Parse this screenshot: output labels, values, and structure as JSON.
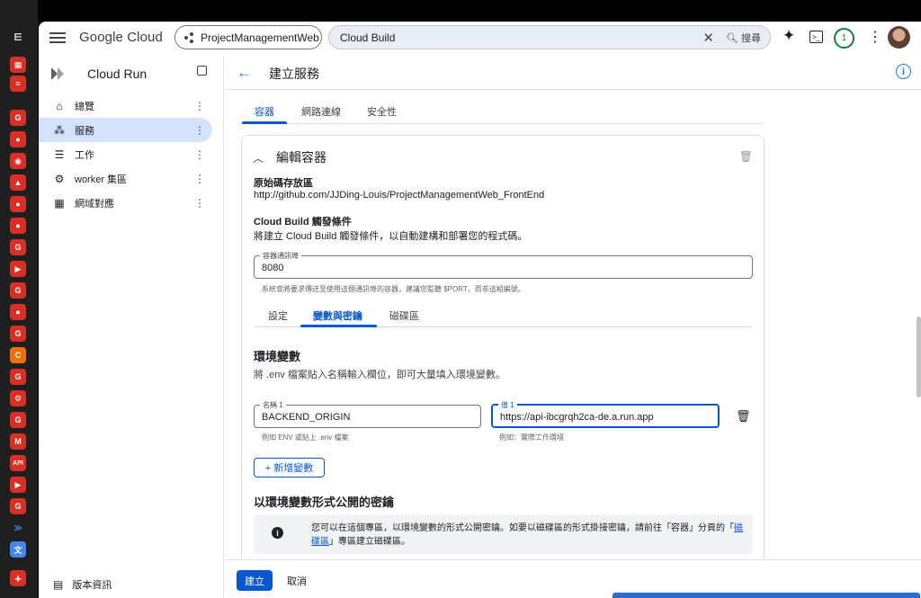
{
  "topbar": {
    "brand": "Google Cloud",
    "project": "ProjectManagementWeb",
    "search_value": "Cloud Build",
    "search_label": "搜尋",
    "notification_count": "1"
  },
  "sidebar": {
    "title": "Cloud Run",
    "items": [
      {
        "label": "總覽",
        "icon": "home-icon"
      },
      {
        "label": "服務",
        "icon": "services-icon"
      },
      {
        "label": "工作",
        "icon": "jobs-icon"
      },
      {
        "label": "worker 集區",
        "icon": "worker-pool-icon"
      },
      {
        "label": "網域對應",
        "icon": "domain-icon"
      }
    ],
    "footer": "版本資訊"
  },
  "page": {
    "title": "建立服務",
    "tabs": [
      "容器",
      "網路連線",
      "安全性"
    ]
  },
  "container": {
    "heading": "編輯容器",
    "repo_label": "原始碼存放區",
    "repo_value": "http://github.com/JJDing-Louis/ProjectManagementWeb_FrontEnd",
    "trigger_label": "Cloud Build 觸發條件",
    "trigger_desc": "將建立 Cloud Build 觸發條件，以自動建構和部署您的程式碼。",
    "port_label": "容器通訊埠",
    "port_value": "8080",
    "port_hint": "系統會將要求傳送至使用這個通訊埠的容器，建議您監聽 $PORT，而非這組編號。",
    "subtabs": [
      "設定",
      "變數與密鑰",
      "磁碟區"
    ],
    "env_title": "環境變數",
    "env_desc": "將 .env 檔案貼入名稱輸入欄位，即可大量填入環境變數。",
    "env_name_label": "名稱 1",
    "env_name_value": "BACKEND_ORIGIN",
    "env_name_hint": "例如 ENV 或貼上 .env 檔案",
    "env_value_label": "值 1",
    "env_value_value": "https://api-ibcgrqh2ca-de.a.run.app",
    "env_value_hint": "例如：實際工作環境",
    "add_var": "+ 新增變數",
    "secret_title": "以環境變數形式公開的密鑰",
    "notice_text_1": "您可以在這個專區，以環境變數的形式公開密鑰。如要以磁碟區的形式掛接密鑰，請前往「容器」分頁的「",
    "notice_link": "磁碟區",
    "notice_text_2": "」專區建立磁碟區。"
  },
  "footer": {
    "create": "建立",
    "cancel": "取消"
  }
}
